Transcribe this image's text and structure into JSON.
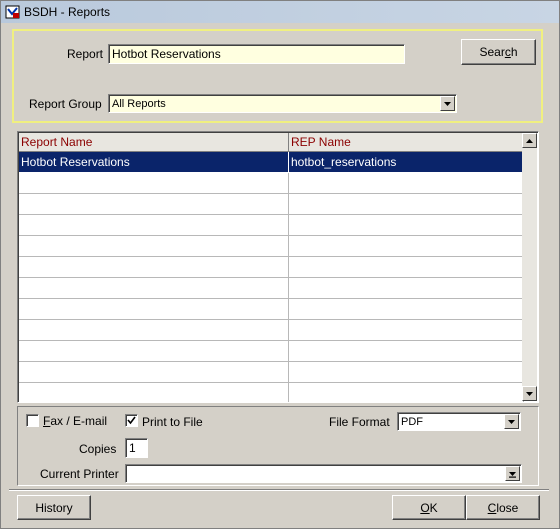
{
  "window": {
    "title": "BSDH - Reports"
  },
  "search": {
    "report_label": "Report",
    "report_value": "Hotbot Reservations",
    "group_label": "Report Group",
    "group_value": "All Reports",
    "search_button": "Search"
  },
  "grid": {
    "columns": [
      "Report Name",
      "REP Name"
    ],
    "rows": [
      {
        "report_name": "Hotbot Reservations",
        "rep_name": "hotbot_reservations",
        "selected": true
      }
    ]
  },
  "options": {
    "fax_email_label": "Fax / E-mail",
    "fax_email_checked": false,
    "print_to_file_label": "Print to File",
    "print_to_file_checked": true,
    "file_format_label": "File Format",
    "file_format_value": "PDF",
    "copies_label": "Copies",
    "copies_value": "1",
    "current_printer_label": "Current Printer",
    "current_printer_value": ""
  },
  "footer": {
    "history_button": "History",
    "ok_button": "OK",
    "close_button": "Close"
  },
  "colors": {
    "selection": "#0a246a",
    "header_text": "#8b0000",
    "field_bg": "#ffffe0",
    "search_frame": "#f0f080"
  }
}
